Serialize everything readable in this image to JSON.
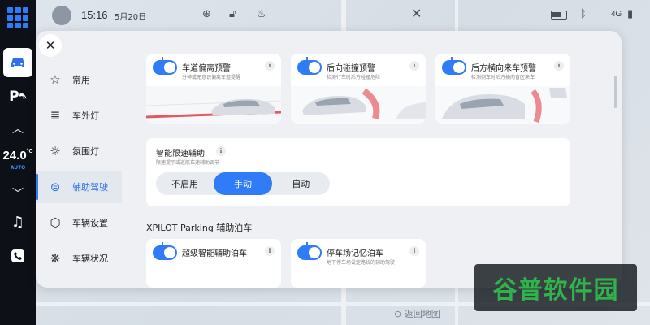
{
  "status_bar": {
    "time": "15:16",
    "date": "5月20日",
    "network": "4G"
  },
  "dock": {
    "temperature": "24.0",
    "temperature_unit": "°C",
    "mode": "AUTO"
  },
  "nav": {
    "items": [
      {
        "label": "常用",
        "icon": "star-icon"
      },
      {
        "label": "车外灯",
        "icon": "headlight-icon"
      },
      {
        "label": "氛围灯",
        "icon": "sun-icon"
      },
      {
        "label": "辅助驾驶",
        "icon": "driver-assist-icon",
        "active": true
      },
      {
        "label": "车辆设置",
        "icon": "hexagon-gear-icon"
      },
      {
        "label": "车辆状况",
        "icon": "wheel-icon"
      }
    ]
  },
  "cards": [
    {
      "title": "车道偏离预警",
      "subtitle": "分神或无意识偏离车道提醒",
      "enabled": true
    },
    {
      "title": "后向碰撞预警",
      "subtitle": "检测行车时后方碰撞危险",
      "enabled": true
    },
    {
      "title": "后方横向来车预警",
      "subtitle": "检测倒车时后方横向盲区来车",
      "enabled": true
    }
  ],
  "speed_limit": {
    "title": "智能限速辅助",
    "subtitle": "限速提示或巡航车速辅助调节",
    "options": [
      "不启用",
      "手动",
      "自动"
    ],
    "selected": "手动"
  },
  "parking": {
    "heading": "XPILOT Parking 辅助泊车",
    "cards": [
      {
        "title": "超级智能辅助泊车",
        "subtitle": "",
        "enabled": true
      },
      {
        "title": "停车场记忆泊车",
        "subtitle": "地下停车场设定路线的辅助驾驶",
        "enabled": true
      }
    ]
  },
  "map": {
    "back_label": "返回地图"
  },
  "watermark": {
    "text": "谷普软件园"
  },
  "colors": {
    "accent": "#2f7cf6",
    "panel_bg": "#eef0f3",
    "dock_bg": "#0d1016",
    "warning_red": "#e0303a"
  }
}
